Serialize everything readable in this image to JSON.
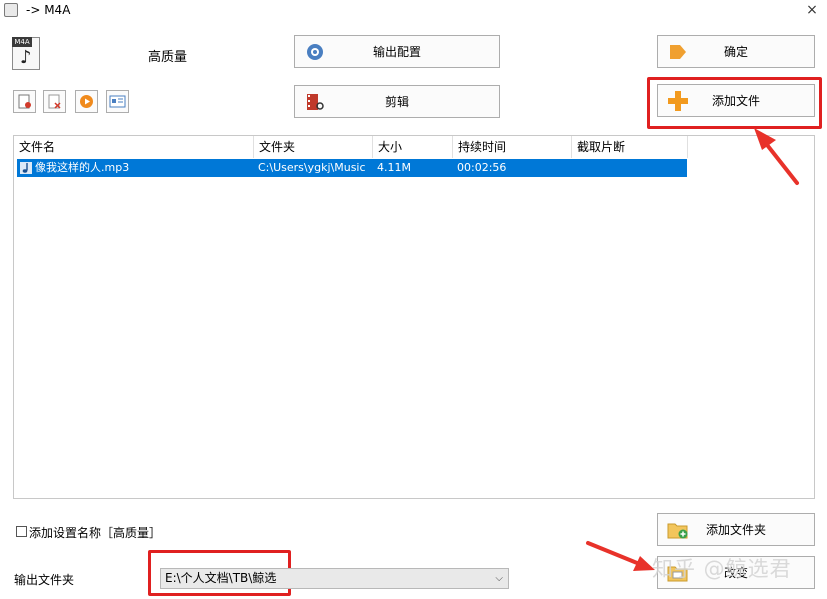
{
  "window": {
    "title": "-> M4A",
    "close_glyph": "×"
  },
  "format": {
    "tag": "M4A",
    "quality": "高质量"
  },
  "buttons": {
    "output_config": "输出配置",
    "confirm": "确定",
    "edit": "剪辑",
    "add_file": "添加文件",
    "add_folder": "添加文件夹",
    "change": "改变"
  },
  "file_list": {
    "columns": [
      "文件名",
      "文件夹",
      "大小",
      "持续时间",
      "截取片断"
    ],
    "rows": [
      {
        "name": "像我这样的人.mp3",
        "folder": "C:\\Users\\ygkj\\Music",
        "size": "4.11M",
        "duration": "00:02:56",
        "clip": ""
      }
    ]
  },
  "options": {
    "add_setting_name": "添加设置名称［高质量］",
    "add_setting_checked": false
  },
  "output": {
    "label": "输出文件夹",
    "path": "E:\\个人文档\\TB\\鲸选"
  },
  "watermark": "知乎 @鲸选君",
  "colors": {
    "selection": "#0078d7",
    "highlight_red": "#e02020",
    "annotation_arrow": "#e8322a"
  },
  "icons": {
    "small_toolbar": [
      "new-file-icon",
      "delete-file-icon",
      "play-icon",
      "properties-icon"
    ]
  }
}
